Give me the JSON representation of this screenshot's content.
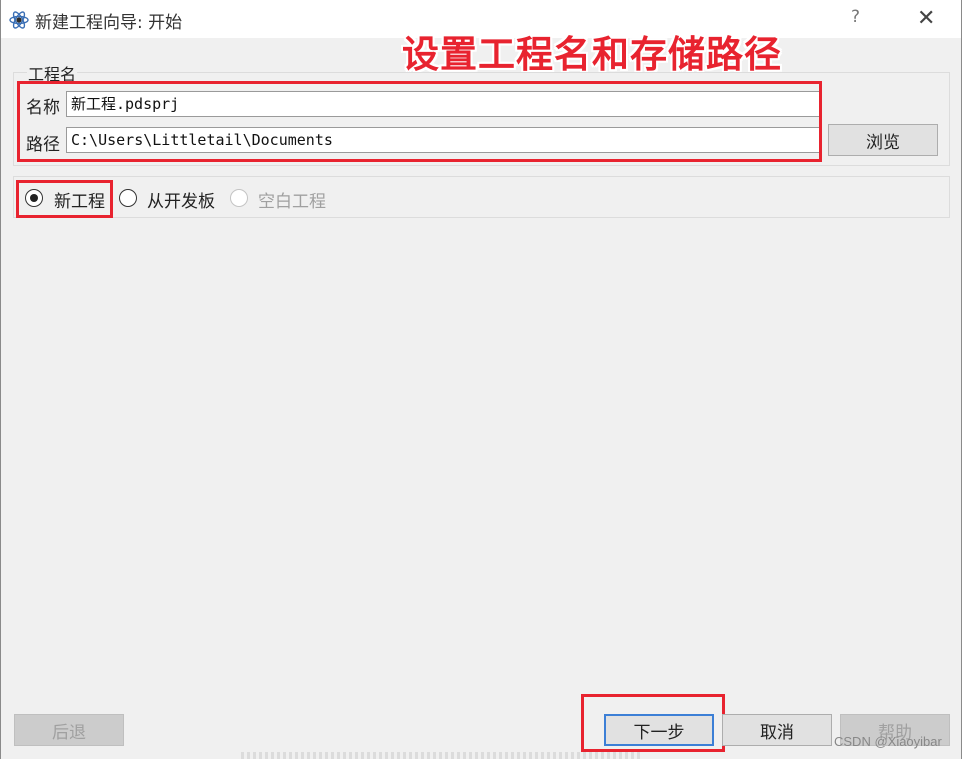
{
  "window": {
    "title": "新建工程向导: 开始",
    "help_glyph": "?",
    "close_glyph": "✕"
  },
  "annotations": {
    "main_label": "设置工程名和存储路径",
    "color": "#e8232f"
  },
  "project_group": {
    "title": "工程名",
    "name_label": "名称",
    "name_value": "新工程.pdsprj",
    "path_label": "路径",
    "path_value": "C:\\Users\\Littletail\\Documents",
    "browse_label": "浏览"
  },
  "project_type": {
    "options": [
      {
        "label": "新工程",
        "checked": true,
        "disabled": false
      },
      {
        "label": "从开发板",
        "checked": false,
        "disabled": false
      },
      {
        "label": "空白工程",
        "checked": false,
        "disabled": true
      }
    ]
  },
  "footer": {
    "back_label": "后退",
    "next_label": "下一步",
    "cancel_label": "取消",
    "help_label": "帮助"
  },
  "watermark": "CSDN @Xiaoyibar"
}
